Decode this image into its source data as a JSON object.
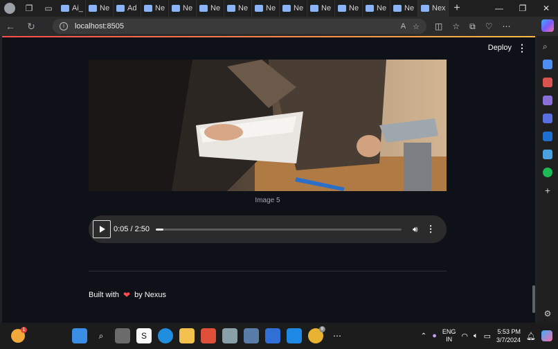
{
  "browser": {
    "tabs": [
      {
        "label": "Ai_",
        "icon": "github-icon"
      },
      {
        "label": "Ne",
        "icon": "book-icon"
      },
      {
        "label": "Ad",
        "icon": "circle-icon"
      },
      {
        "label": "Ne",
        "icon": "shield-icon"
      },
      {
        "label": "Ne",
        "icon": "shield-icon"
      },
      {
        "label": "Ne",
        "icon": "page-icon"
      },
      {
        "label": "Ne",
        "icon": "book-icon"
      },
      {
        "label": "Ne",
        "icon": "book-icon"
      },
      {
        "label": "Ne",
        "icon": "book-icon"
      },
      {
        "label": "Ne",
        "icon": "book-icon"
      },
      {
        "label": "Ne",
        "icon": "book-icon"
      },
      {
        "label": "Ne",
        "icon": "book-icon"
      },
      {
        "label": "Ne",
        "icon": "book-icon"
      }
    ],
    "active_tab": {
      "label": "Nex"
    },
    "url": "localhost:8505"
  },
  "app": {
    "deploy_label": "Deploy",
    "image_caption": "Image 5",
    "audio": {
      "time": "0:05 / 2:50",
      "progress": 0.03
    },
    "footer_prefix": "Built with",
    "footer_suffix": "by Nexus"
  },
  "taskbar": {
    "weather_badge": "1",
    "chrome_badge": "8",
    "lang_top": "ENG",
    "lang_bottom": "IN",
    "time": "5:53 PM",
    "date": "3/7/2024"
  }
}
